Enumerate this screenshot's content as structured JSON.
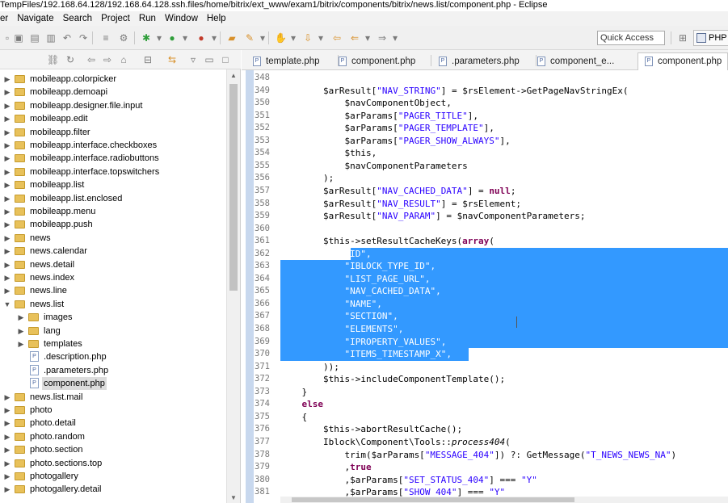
{
  "window": {
    "title": "TempFiles/192.168.64.128/192.168.64.128.ssh.files/home/bitrix/ext_www/exam1/bitrix/components/bitrix/news.list/component.php - Eclipse"
  },
  "menu": [
    "er",
    "Navigate",
    "Search",
    "Project",
    "Run",
    "Window",
    "Help"
  ],
  "toolbar": {
    "quick_access_label": "Quick Access",
    "perspective_label": "PHP"
  },
  "explorer": {
    "tree": [
      {
        "label": "mobileapp.colorpicker",
        "type": "folder",
        "depth": 0,
        "expanded": false
      },
      {
        "label": "mobileapp.demoapi",
        "type": "folder",
        "depth": 0,
        "expanded": false
      },
      {
        "label": "mobileapp.designer.file.input",
        "type": "folder",
        "depth": 0,
        "expanded": false
      },
      {
        "label": "mobileapp.edit",
        "type": "folder",
        "depth": 0,
        "expanded": false
      },
      {
        "label": "mobileapp.filter",
        "type": "folder",
        "depth": 0,
        "expanded": false
      },
      {
        "label": "mobileapp.interface.checkboxes",
        "type": "folder",
        "depth": 0,
        "expanded": false
      },
      {
        "label": "mobileapp.interface.radiobuttons",
        "type": "folder",
        "depth": 0,
        "expanded": false
      },
      {
        "label": "mobileapp.interface.topswitchers",
        "type": "folder",
        "depth": 0,
        "expanded": false
      },
      {
        "label": "mobileapp.list",
        "type": "folder",
        "depth": 0,
        "expanded": false
      },
      {
        "label": "mobileapp.list.enclosed",
        "type": "folder",
        "depth": 0,
        "expanded": false
      },
      {
        "label": "mobileapp.menu",
        "type": "folder",
        "depth": 0,
        "expanded": false
      },
      {
        "label": "mobileapp.push",
        "type": "folder",
        "depth": 0,
        "expanded": false
      },
      {
        "label": "news",
        "type": "folder",
        "depth": 0,
        "expanded": false
      },
      {
        "label": "news.calendar",
        "type": "folder",
        "depth": 0,
        "expanded": false
      },
      {
        "label": "news.detail",
        "type": "folder",
        "depth": 0,
        "expanded": false
      },
      {
        "label": "news.index",
        "type": "folder",
        "depth": 0,
        "expanded": false
      },
      {
        "label": "news.line",
        "type": "folder",
        "depth": 0,
        "expanded": false
      },
      {
        "label": "news.list",
        "type": "folder",
        "depth": 0,
        "expanded": true
      },
      {
        "label": "images",
        "type": "folder",
        "depth": 1,
        "expanded": false
      },
      {
        "label": "lang",
        "type": "folder",
        "depth": 1,
        "expanded": false
      },
      {
        "label": "templates",
        "type": "folder",
        "depth": 1,
        "expanded": false
      },
      {
        "label": ".description.php",
        "type": "file",
        "depth": 1
      },
      {
        "label": ".parameters.php",
        "type": "file",
        "depth": 1
      },
      {
        "label": "component.php",
        "type": "file",
        "depth": 1,
        "selected": true
      },
      {
        "label": "news.list.mail",
        "type": "folder",
        "depth": 0,
        "expanded": false
      },
      {
        "label": "photo",
        "type": "folder",
        "depth": 0,
        "expanded": false
      },
      {
        "label": "photo.detail",
        "type": "folder",
        "depth": 0,
        "expanded": false
      },
      {
        "label": "photo.random",
        "type": "folder",
        "depth": 0,
        "expanded": false
      },
      {
        "label": "photo.section",
        "type": "folder",
        "depth": 0,
        "expanded": false
      },
      {
        "label": "photo.sections.top",
        "type": "folder",
        "depth": 0,
        "expanded": false
      },
      {
        "label": "photogallery",
        "type": "folder",
        "depth": 0,
        "expanded": false
      },
      {
        "label": "photogallery.detail",
        "type": "folder",
        "depth": 0,
        "expanded": false
      }
    ]
  },
  "editor": {
    "tabs": [
      {
        "label": "template.php",
        "active": false
      },
      {
        "label": "component.php",
        "active": false
      },
      {
        "label": ".parameters.php",
        "active": false
      },
      {
        "label": "component_e...",
        "active": false
      },
      {
        "label": "component.php",
        "active": true
      }
    ],
    "lines": [
      {
        "n": "348",
        "code": ""
      },
      {
        "n": "349",
        "code": "        $arResult[\"NAV_STRING\"] = $rsElement->GetPageNavStringEx("
      },
      {
        "n": "350",
        "code": "            $navComponentObject,"
      },
      {
        "n": "351",
        "code": "            $arParams[\"PAGER_TITLE\"],"
      },
      {
        "n": "352",
        "code": "            $arParams[\"PAGER_TEMPLATE\"],"
      },
      {
        "n": "353",
        "code": "            $arParams[\"PAGER_SHOW_ALWAYS\"],"
      },
      {
        "n": "354",
        "code": "            $this,"
      },
      {
        "n": "355",
        "code": "            $navComponentParameters"
      },
      {
        "n": "356",
        "code": "        );"
      },
      {
        "n": "357",
        "code": "        $arResult[\"NAV_CACHED_DATA\"] = null;"
      },
      {
        "n": "358",
        "code": "        $arResult[\"NAV_RESULT\"] = $rsElement;"
      },
      {
        "n": "359",
        "code": "        $arResult[\"NAV_PARAM\"] = $navComponentParameters;"
      },
      {
        "n": "360",
        "code": ""
      },
      {
        "n": "361",
        "code": "        $this->setResultCacheKeys(array("
      },
      {
        "n": "362",
        "code": "            \"ID\","
      },
      {
        "n": "363",
        "code": "            \"IBLOCK_TYPE_ID\","
      },
      {
        "n": "364",
        "code": "            \"LIST_PAGE_URL\","
      },
      {
        "n": "365",
        "code": "            \"NAV_CACHED_DATA\","
      },
      {
        "n": "366",
        "code": "            \"NAME\","
      },
      {
        "n": "367",
        "code": "            \"SECTION\","
      },
      {
        "n": "368",
        "code": "            \"ELEMENTS\","
      },
      {
        "n": "369",
        "code": "            \"IPROPERTY_VALUES\","
      },
      {
        "n": "370",
        "code": "            \"ITEMS_TIMESTAMP_X\","
      },
      {
        "n": "371",
        "code": "        ));"
      },
      {
        "n": "372",
        "code": "        $this->includeComponentTemplate();"
      },
      {
        "n": "373",
        "code": "    }"
      },
      {
        "n": "374",
        "code": "    else"
      },
      {
        "n": "375",
        "code": "    {"
      },
      {
        "n": "376",
        "code": "        $this->abortResultCache();"
      },
      {
        "n": "377",
        "code": "        Iblock\\Component\\Tools::process404("
      },
      {
        "n": "378",
        "code": "            trim($arParams[\"MESSAGE_404\"]) ?: GetMessage(\"T_NEWS_NEWS_NA\")"
      },
      {
        "n": "379",
        "code": "            ,true"
      },
      {
        "n": "380",
        "code": "            ,$arParams[\"SET_STATUS_404\"] === \"Y\""
      },
      {
        "n": "381",
        "code": "            ,$arParams[\"SHOW_404\"] === \"Y\""
      }
    ]
  }
}
